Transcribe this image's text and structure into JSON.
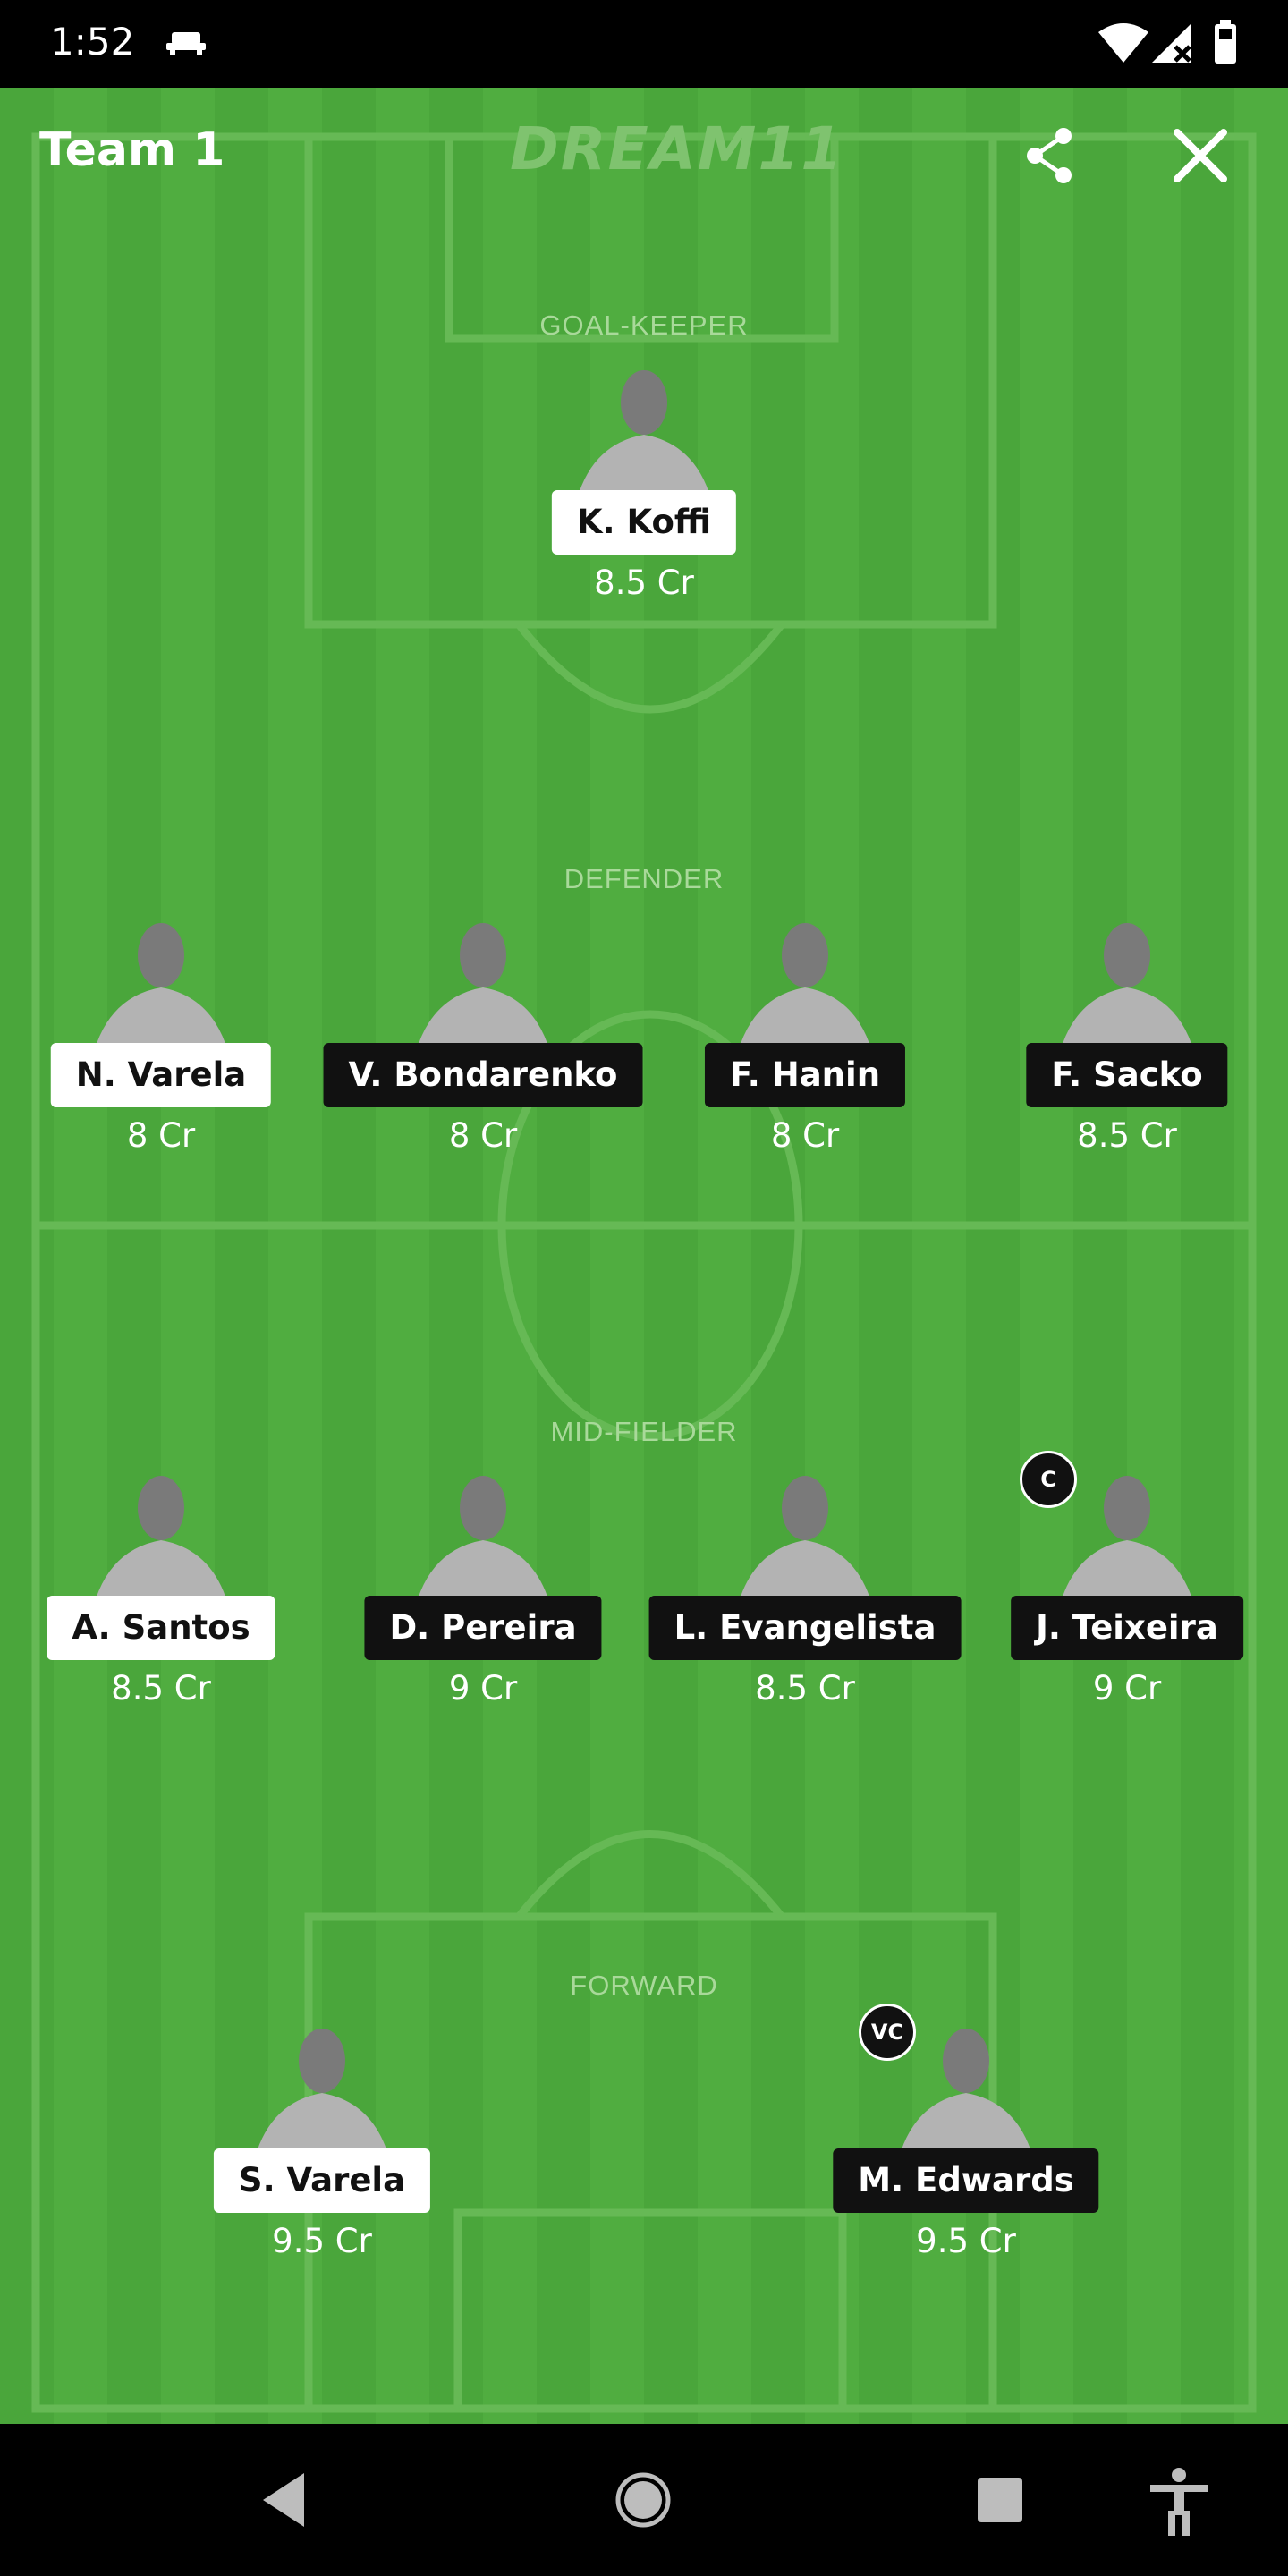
{
  "status_bar": {
    "time": "1:52",
    "icons": [
      "notification-icon",
      "wifi-icon",
      "signal-icon",
      "battery-icon"
    ]
  },
  "header": {
    "title": "Team 1",
    "logo_text": "DREAM11",
    "share_icon": "share-icon",
    "close_icon": "close-icon"
  },
  "sections": {
    "goalkeeper": "GOAL-KEEPER",
    "defender": "DEFENDER",
    "midfielder": "MID-FIELDER",
    "forward": "FORWARD"
  },
  "players": {
    "gk1": {
      "name": "K. Koffi",
      "credits": "8.5 Cr"
    },
    "def1": {
      "name": "N. Varela",
      "credits": "8 Cr"
    },
    "def2": {
      "name": "V. Bondarenko",
      "credits": "8 Cr"
    },
    "def3": {
      "name": "F. Hanin",
      "credits": "8 Cr"
    },
    "def4": {
      "name": "F. Sacko",
      "credits": "8.5 Cr"
    },
    "mid1": {
      "name": "A. Santos",
      "credits": "8.5 Cr"
    },
    "mid2": {
      "name": "D. Pereira",
      "credits": "9 Cr"
    },
    "mid3": {
      "name": "L. Evangelista",
      "credits": "8.5 Cr"
    },
    "mid4": {
      "name": "J. Teixeira",
      "credits": "9 Cr",
      "badge": "C"
    },
    "fwd1": {
      "name": "S. Varela",
      "credits": "9.5 Cr"
    },
    "fwd2": {
      "name": "M. Edwards",
      "credits": "9.5 Cr",
      "badge": "VC"
    }
  },
  "nav": {
    "icons": [
      "back-icon",
      "home-icon",
      "recents-icon",
      "accessibility-icon"
    ]
  },
  "colors": {
    "field_light": "#50ad40",
    "field_dark": "#4aa63b",
    "field_lines": "#66b955",
    "team_label_light": "#ffffff",
    "team_label_dark": "#111111"
  }
}
